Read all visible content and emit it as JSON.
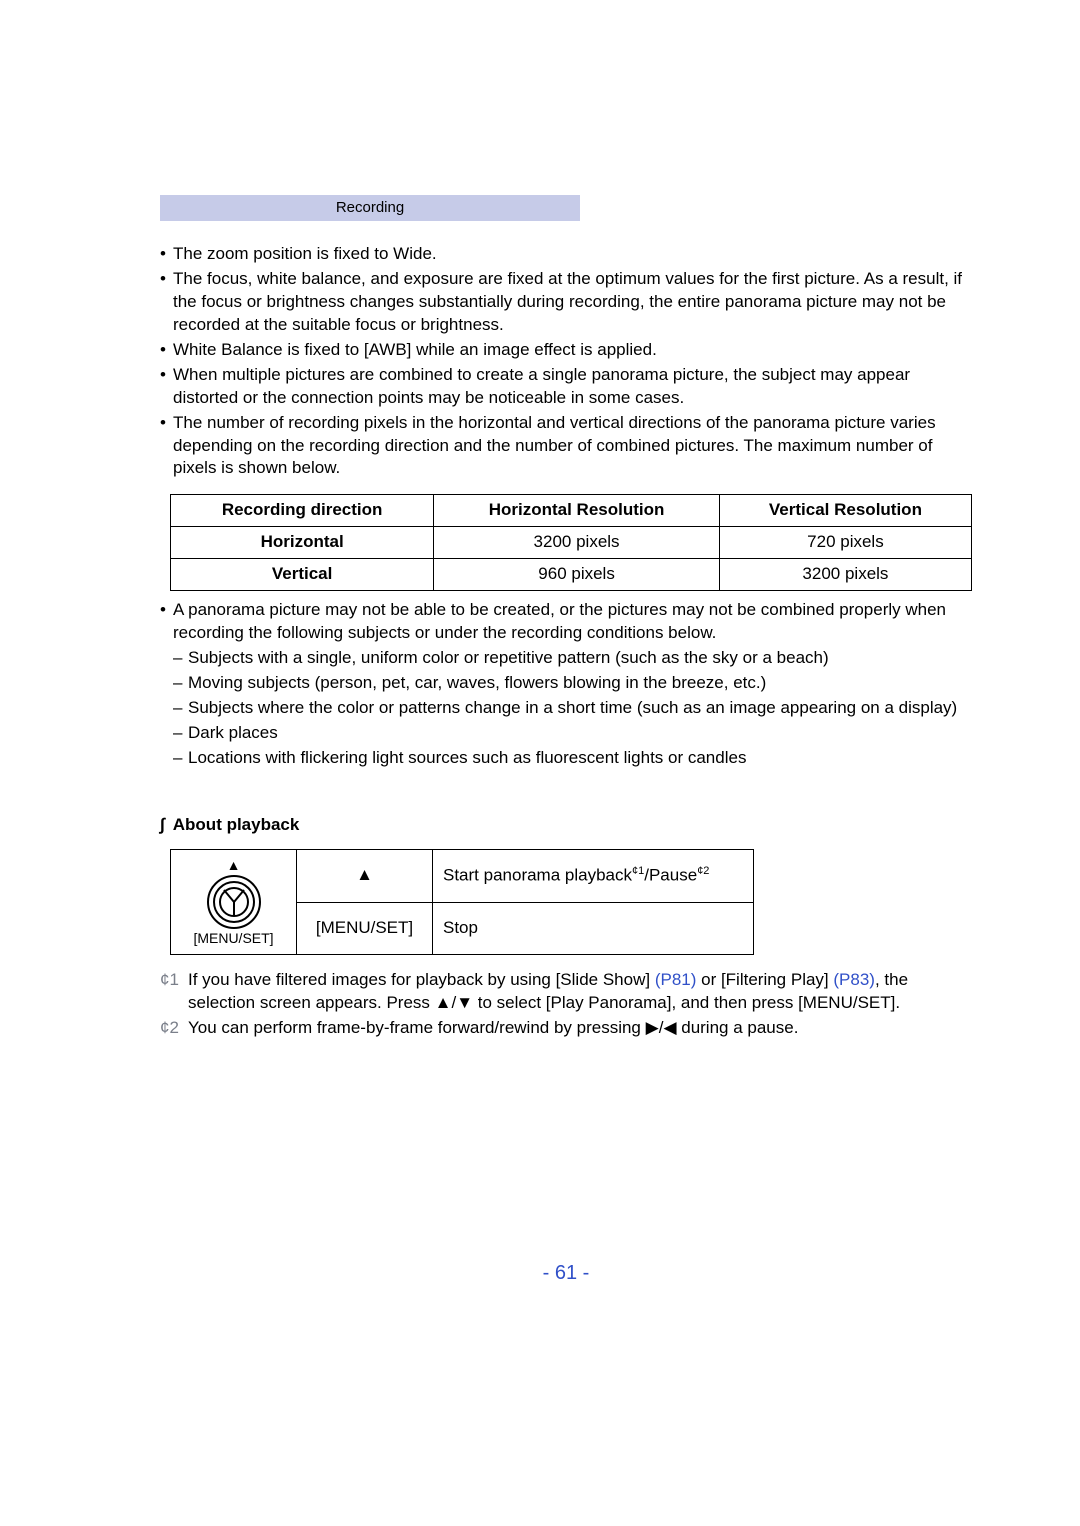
{
  "header": {
    "title": "Recording"
  },
  "bullets_top": [
    "The zoom position is fixed to Wide.",
    "The focus, white balance, and exposure are fixed at the optimum values for the first picture. As a result, if the focus or brightness changes substantially during recording, the entire panorama picture may not be recorded at the suitable focus or brightness.",
    "White Balance is fixed to [AWB] while an image effect is applied.",
    "When multiple pictures are combined to create a single panorama picture, the subject may appear distorted or the connection points may be noticeable in some cases.",
    "The number of recording pixels in the horizontal and vertical directions of the panorama picture varies depending on the recording direction and the number of combined pictures. The maximum number of pixels is shown below."
  ],
  "table1": {
    "headers": [
      "Recording direction",
      "Horizontal Resolution",
      "Vertical Resolution"
    ],
    "rows": [
      [
        "Horizontal",
        "3200 pixels",
        "720 pixels"
      ],
      [
        "Vertical",
        "960 pixels",
        "3200 pixels"
      ]
    ]
  },
  "bullet_after": {
    "lead": "A panorama picture may not be able to be created, or the pictures may not be combined properly when recording the following subjects or under the recording conditions below.",
    "items": [
      "Subjects with a single, uniform color or repetitive pattern (such as the sky or a beach)",
      "Moving subjects (person, pet, car, waves, flowers blowing in the breeze, etc.)",
      "Subjects where the color or patterns change in a short time (such as an image appearing on a display)",
      "Dark places",
      "Locations with flickering light sources such as fluorescent lights or candles"
    ]
  },
  "section_title": "About playback",
  "diagram_label": "[MENU/SET]",
  "table2": {
    "rows": [
      {
        "key_glyph": "▲",
        "action_pre": "Start panorama playback",
        "sup1": "¢1",
        "action_mid": "/Pause",
        "sup2": "¢2"
      },
      {
        "key_text": "[MENU/SET]",
        "action": "Stop"
      }
    ]
  },
  "footnotes": [
    {
      "mark": "¢1",
      "parts": [
        {
          "t": "If you have filtered images for playback by using [Slide Show] "
        },
        {
          "t": "(P81)",
          "link": true
        },
        {
          "t": " or [Filtering Play] "
        },
        {
          "t": "(P83)",
          "link": true
        },
        {
          "t": ", the selection screen appears. Press "
        },
        {
          "g": "▲"
        },
        {
          "t": "/"
        },
        {
          "g": "▼"
        },
        {
          "t": " to select [Play Panorama], and then press [MENU/SET]."
        }
      ]
    },
    {
      "mark": "¢2",
      "parts": [
        {
          "t": "You can perform frame-by-frame forward/rewind by pressing "
        },
        {
          "g": "▶"
        },
        {
          "t": "/"
        },
        {
          "g": "◀"
        },
        {
          "t": " during a pause."
        }
      ]
    }
  ],
  "page_number": "- 61 -"
}
